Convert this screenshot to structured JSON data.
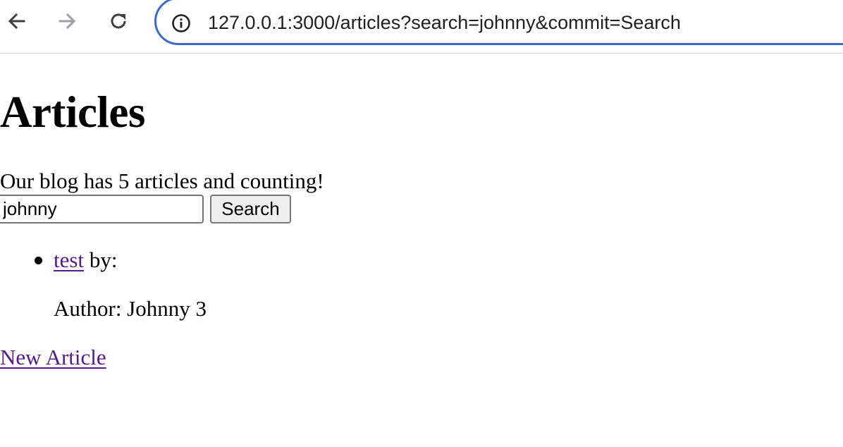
{
  "browser": {
    "url": "127.0.0.1:3000/articles?search=johnny&commit=Search",
    "icons": {
      "back": "arrow-left-icon",
      "forward": "arrow-right-icon",
      "reload": "reload-icon",
      "site_info": "info-circle-icon"
    },
    "colors": {
      "omnibox_border": "#3a6bc9",
      "forward_disabled": "#9aa0a6"
    }
  },
  "page": {
    "title": "Articles",
    "count_text": "Our blog has 5 articles and counting!",
    "search": {
      "value": "johnny",
      "button_label": "Search"
    },
    "articles": [
      {
        "title": "test",
        "by_text": " by:",
        "author_text": "Author: Johnny 3"
      }
    ],
    "new_article_label": "New Article",
    "colors": {
      "visited_link": "#551a8b"
    }
  }
}
